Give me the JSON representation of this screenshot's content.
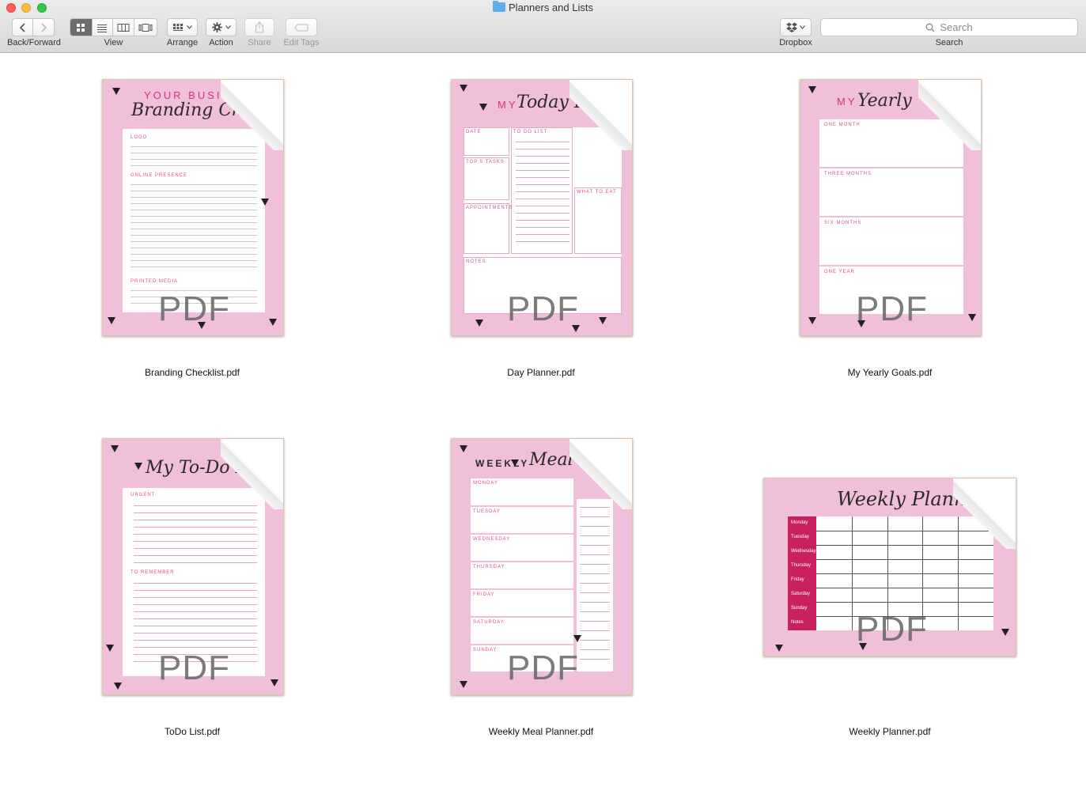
{
  "window": {
    "title": "Planners and Lists"
  },
  "toolbar": {
    "back_forward_label": "Back/Forward",
    "view_label": "View",
    "arrange_label": "Arrange",
    "action_label": "Action",
    "share_label": "Share",
    "edit_tags_label": "Edit Tags",
    "dropbox_label": "Dropbox",
    "search_label": "Search",
    "search_placeholder": "Search",
    "active_view": "icon"
  },
  "files": [
    {
      "name": "Branding Checklist.pdf",
      "badge": "PDF",
      "orientation": "portrait"
    },
    {
      "name": "Day Planner.pdf",
      "badge": "PDF",
      "orientation": "portrait"
    },
    {
      "name": "My Yearly Goals.pdf",
      "badge": "PDF",
      "orientation": "portrait"
    },
    {
      "name": "ToDo List.pdf",
      "badge": "PDF",
      "orientation": "portrait"
    },
    {
      "name": "Weekly Meal Planner.pdf",
      "badge": "PDF",
      "orientation": "portrait"
    },
    {
      "name": "Weekly Planner.pdf",
      "badge": "PDF",
      "orientation": "landscape"
    }
  ],
  "thumbnails": {
    "branding": {
      "title_top": "YOUR BUSI",
      "title_script": "Branding Che",
      "sections": [
        "LOGO",
        "ONLINE PRESENCE",
        "PRINTED MEDIA"
      ]
    },
    "day": {
      "title_top": "MY",
      "title_script": "Today P",
      "sections": [
        "DATE",
        "TO DO LIST",
        "TOP 5 TASKS",
        "APPOINTMENTS",
        "WHAT TO EAT",
        "NOTES"
      ]
    },
    "yearly": {
      "title_top": "MY",
      "title_script": "Yearly",
      "sections": [
        "ONE MONTH",
        "THREE MONTHS",
        "SIX MONTHS",
        "ONE YEAR"
      ]
    },
    "todo": {
      "title_script": "My To-Do L",
      "sections": [
        "URGENT",
        "TO REMEMBER"
      ]
    },
    "meal": {
      "title_top": "WEEKLY",
      "title_script": "Meal",
      "days": [
        "MONDAY",
        "TUESDAY",
        "WEDNESDAY",
        "THURSDAY",
        "FRIDAY",
        "SATURDAY",
        "SUNDAY"
      ]
    },
    "weekly": {
      "title_script": "Weekly Planner",
      "days": [
        "Monday",
        "Tuesday",
        "Wednesday",
        "Thursday",
        "Friday",
        "Saturday",
        "Sunday",
        "Notes"
      ]
    }
  },
  "colors": {
    "thumb_pink": "#f0bfd9",
    "accent_magenta": "#c9205f",
    "selected_view": "#6d6d6d"
  }
}
